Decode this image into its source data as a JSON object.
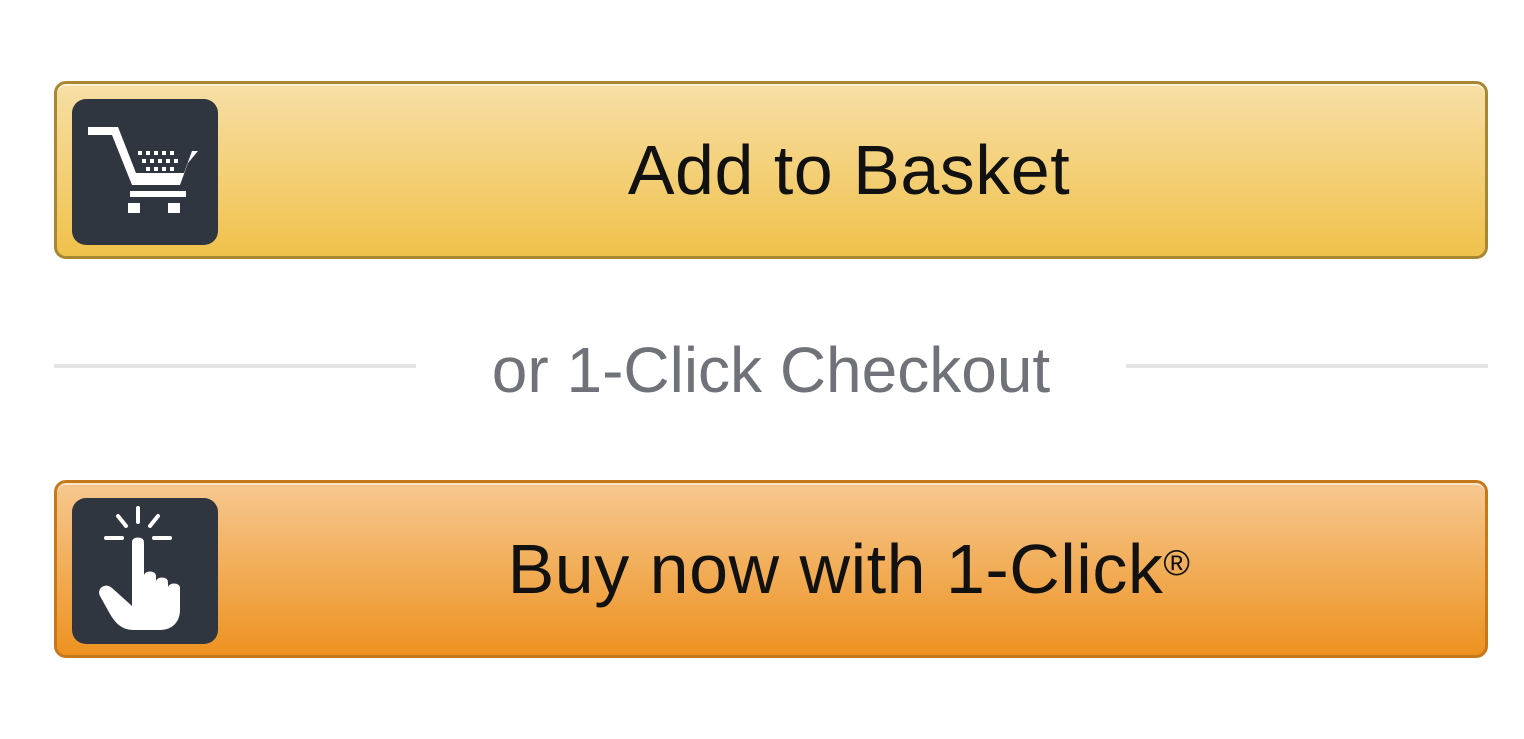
{
  "add_to_basket": {
    "label": "Add to Basket",
    "icon": "shopping-cart-icon",
    "border_color": "#a88734",
    "gradient_top": "#f7dfa5",
    "gradient_bottom": "#f0c14b"
  },
  "divider": {
    "text": "or 1-Click Checkout"
  },
  "buy_now": {
    "label": "Buy now with 1-Click",
    "registered_mark": "®",
    "icon": "hand-pointer-icon",
    "border_color": "#c6791b",
    "gradient_top": "#f6c88f",
    "gradient_bottom": "#ed9220"
  },
  "icon_box_color": "#2f3640"
}
